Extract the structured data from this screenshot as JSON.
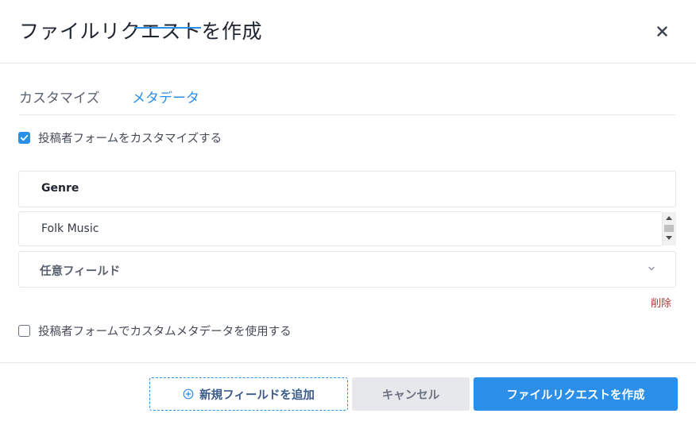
{
  "dialog": {
    "title": "ファイルリクエストを作成"
  },
  "tabs": [
    {
      "label": "カスタマイズ",
      "active": false
    },
    {
      "label": "メタデータ",
      "active": true
    }
  ],
  "customize_form": {
    "label": "投稿者フォームをカスタマイズする",
    "checked": true
  },
  "field": {
    "name": "Genre",
    "value": "Folk Music",
    "optional_label": "任意フィールド",
    "delete_label": "削除"
  },
  "custom_metadata": {
    "label": "投稿者フォームでカスタムメタデータを使用する",
    "checked": false
  },
  "footer": {
    "add_field_label": "新規フィールドを追加",
    "cancel_label": "キャンセル",
    "create_label": "ファイルリクエストを作成"
  },
  "colors": {
    "accent": "#2b8fe8",
    "danger": "#b03a3a",
    "secondary_button": "#e6e8ec"
  },
  "icons": {
    "close": "close-icon",
    "check": "checkmark-icon",
    "chevron": "chevron-down-icon",
    "add": "plus-circle-icon"
  }
}
